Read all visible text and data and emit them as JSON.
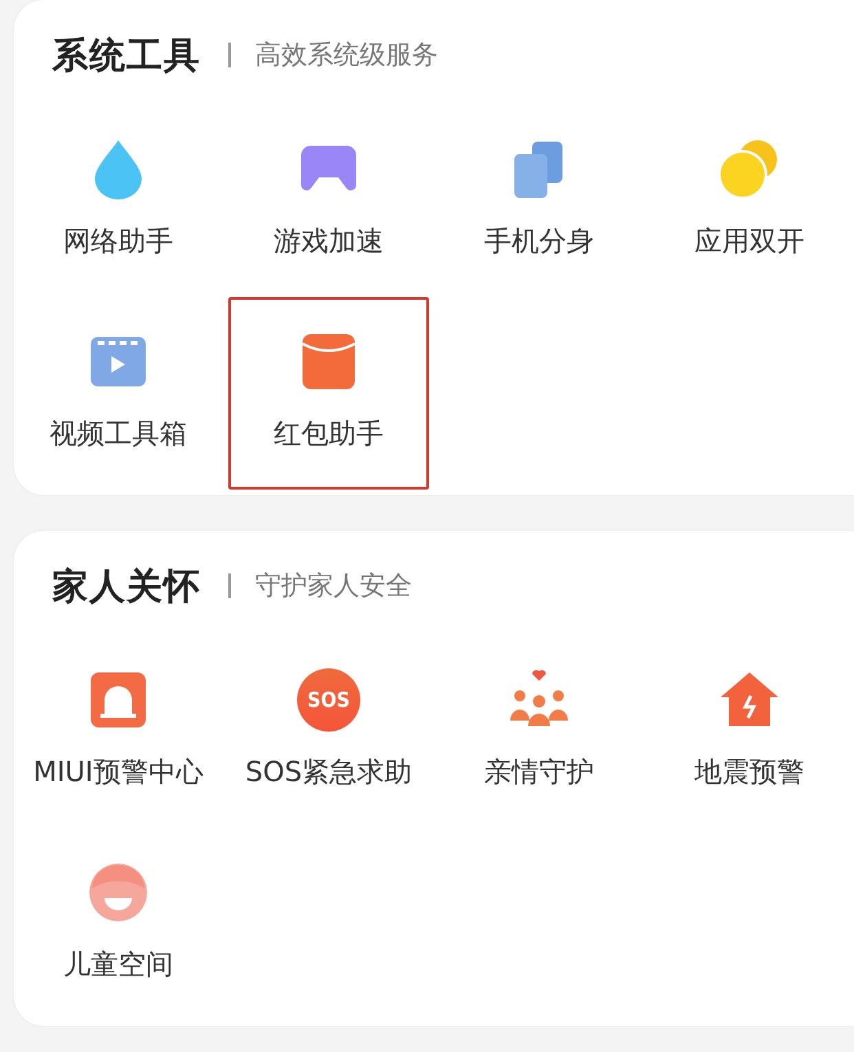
{
  "sections": [
    {
      "title": "系统工具",
      "subtitle": "高效系统级服务",
      "items": [
        {
          "kind": "drop",
          "label": "网络助手",
          "highlighted": false
        },
        {
          "kind": "gamepad",
          "label": "游戏加速",
          "highlighted": false
        },
        {
          "kind": "cards",
          "label": "手机分身",
          "highlighted": false
        },
        {
          "kind": "coins",
          "label": "应用双开",
          "highlighted": false
        },
        {
          "kind": "video",
          "label": "视频工具箱",
          "highlighted": false
        },
        {
          "kind": "envelope",
          "label": "红包助手",
          "highlighted": true
        }
      ]
    },
    {
      "title": "家人关怀",
      "subtitle": "守护家人安全",
      "items": [
        {
          "kind": "alarm",
          "label": "MIUI预警中心",
          "highlighted": false
        },
        {
          "kind": "sos",
          "icon_text": "SOS",
          "label": "SOS紧急求助",
          "highlighted": false
        },
        {
          "kind": "family",
          "label": "亲情守护",
          "highlighted": false
        },
        {
          "kind": "house",
          "label": "地震预警",
          "highlighted": false
        },
        {
          "kind": "child",
          "label": "儿童空间",
          "highlighted": false
        }
      ]
    }
  ]
}
